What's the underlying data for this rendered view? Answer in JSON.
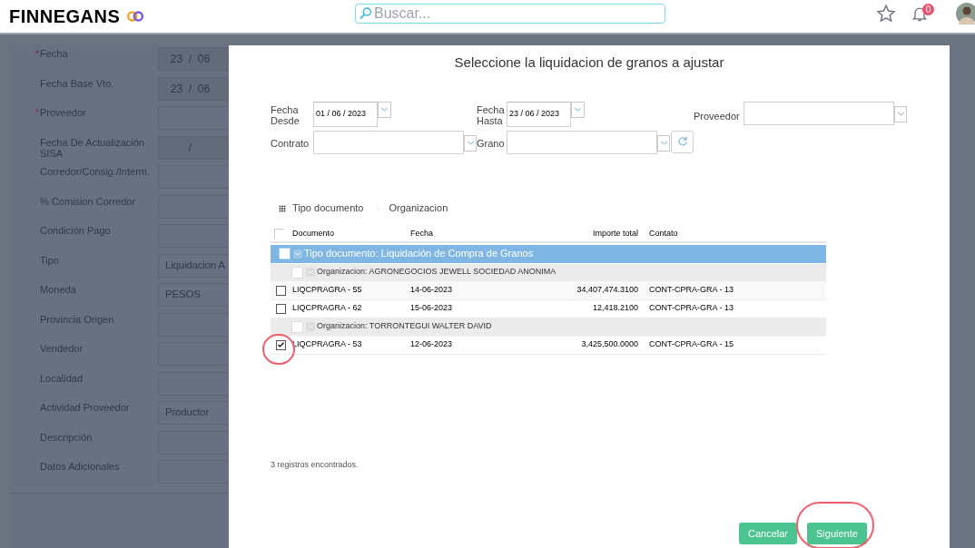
{
  "header": {
    "logo_text": "FINNEGANS",
    "search_placeholder": "Buscar...",
    "notification_count": "0"
  },
  "background_form": {
    "required_mark": "*",
    "fields": [
      {
        "label": "Fecha",
        "required": true,
        "value": "23  /  06",
        "kind": "date"
      },
      {
        "label": "Fecha Base Vto.",
        "required": false,
        "value": "23  /  06",
        "kind": "date"
      },
      {
        "label": "Proveedor",
        "required": true,
        "kind": "input"
      },
      {
        "label": "Fecha De Actualización SISA",
        "required": false,
        "value": "/",
        "kind": "date"
      },
      {
        "label": "Corredor/Consig./Interm.",
        "required": false,
        "kind": "input"
      },
      {
        "label": "% Comision Corredor",
        "required": false,
        "kind": "input"
      },
      {
        "label": "Condición Pago",
        "required": false,
        "kind": "input"
      },
      {
        "label": "Tipo",
        "required": false,
        "value": "Liquidacion A",
        "kind": "input"
      },
      {
        "label": "Moneda",
        "required": false,
        "value": "PESOS",
        "kind": "input"
      },
      {
        "label": "Provincia Origen",
        "required": false,
        "kind": "input"
      },
      {
        "label": "Vendedor",
        "required": false,
        "kind": "input"
      },
      {
        "label": "Localidad",
        "required": false,
        "kind": "input"
      },
      {
        "label": "Actividad Proveedor",
        "required": false,
        "value": "Productor",
        "kind": "input"
      },
      {
        "label": "Descripción",
        "required": false,
        "kind": "input"
      },
      {
        "label": "Datos Adicionales",
        "required": false,
        "kind": "input"
      }
    ]
  },
  "dialog": {
    "title": "Seleccione la liquidacion de granos a ajustar",
    "filters": [
      {
        "label": "Fecha Desde",
        "kind": "date",
        "value": "01 / 06 / 2023"
      },
      {
        "label": "Fecha Hasta",
        "kind": "date",
        "value": "23 / 06 / 2023"
      },
      {
        "label": "Proveedor",
        "kind": "select"
      },
      {
        "label": "Contrato",
        "kind": "select"
      },
      {
        "label": "Grano",
        "kind": "select"
      }
    ],
    "grouping": [
      "Tipo documento",
      "Organizacion"
    ],
    "table": {
      "header_checked": false,
      "columns": [
        "Documento",
        "Fecha",
        "Importe total",
        "Contato"
      ],
      "rows": [
        {
          "kind": "group",
          "text": "Tipo documento: Liquidación de Compra de Granos",
          "checked": false,
          "highlighted": false
        },
        {
          "kind": "subgroup",
          "text": "Organizacion: AGRONEGOCIOS JEWELL SOCIEDAD ANONIMA",
          "checked": false,
          "highlighted": false
        },
        {
          "kind": "item",
          "cells": [
            "LIQCPRAGRA - 55",
            "14-06-2023",
            "34,407,474.3100",
            "CONT-CPRA-GRA - 13"
          ],
          "checked": false,
          "highlighted": false
        },
        {
          "kind": "item",
          "cells": [
            "LIQCPRAGRA - 62",
            "15-06-2023",
            "12,418.2100",
            "CONT-CPRA-GRA - 13"
          ],
          "checked": false,
          "highlighted": false
        },
        {
          "kind": "subgroup",
          "text": "Organizacion: TORRONTEGUI WALTER DAVID",
          "checked": false,
          "highlighted": false
        },
        {
          "kind": "item",
          "cells": [
            "LIQCPRAGRA - 53",
            "12-06-2023",
            "3,425,500.0000",
            "CONT-CPRA-GRA - 15"
          ],
          "checked": true,
          "highlighted": true
        }
      ]
    },
    "count_text": "3 registros encontrados.",
    "buttons": [
      {
        "label": "Cancelar",
        "highlighted": false
      },
      {
        "label": "Siguiente",
        "highlighted": true
      }
    ]
  }
}
